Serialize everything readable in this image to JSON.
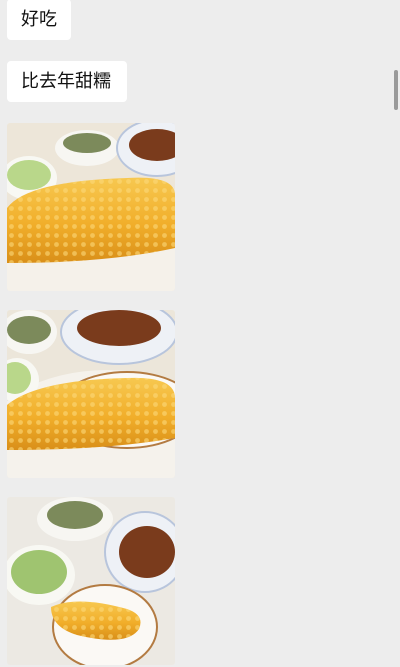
{
  "messages": [
    {
      "type": "text",
      "text": "好吃"
    },
    {
      "type": "text",
      "text": "比去年甜糯"
    }
  ],
  "images": [
    {
      "icon": "photo-corn-dinner-1"
    },
    {
      "icon": "photo-corn-dinner-2"
    },
    {
      "icon": "photo-corn-dinner-3"
    }
  ],
  "colors": {
    "background": "#ededed",
    "bubble": "#ffffff",
    "corn": "#f3b431"
  }
}
